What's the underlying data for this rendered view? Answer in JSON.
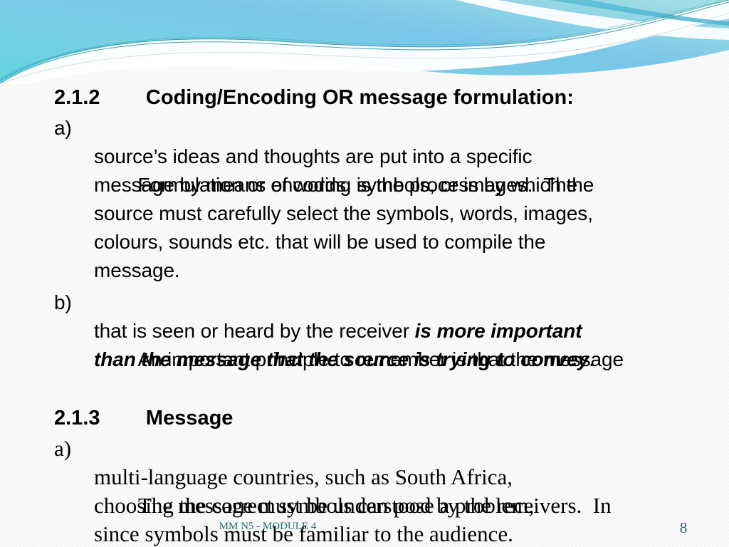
{
  "slide": {
    "background_color": "#fbfbfb",
    "accent_color": "#5ec8dd",
    "footer_color": "#1f6b73"
  },
  "sections": [
    {
      "heading": "2.1.2\tCoding/Encoding OR message formulation:",
      "font": "sans",
      "items": [
        {
          "marker": "a)",
          "lines": [
            "Formulation or encoding is the process by which the",
            "source’s ideas and thoughts are put into a specific",
            "message by means of words, symbols, or images.  The",
            "source must carefully select the symbols, words, images,",
            "colours, sounds etc. that will be used to compile the",
            "message."
          ]
        },
        {
          "marker": "b)",
          "lines": [
            "An important principle to remember is that the message",
            "that is seen or heard by the receiver ",
            "is more important",
            "than the message that the source is trying to convey",
            "."
          ],
          "emphasis_note": "is more important than the message that the source is trying to convey"
        }
      ]
    },
    {
      "heading": "2.1.3\tMessage",
      "font": "serif",
      "items": [
        {
          "marker": "a)",
          "lines": [
            "The message must be understood by the receivers.  In",
            "multi-language countries, such as South Africa,",
            "choosing the correct symbols can pose a problem,",
            "since symbols must be familiar to the audience."
          ]
        }
      ]
    }
  ],
  "footer": {
    "text": "MM N5 - MODULE 4",
    "page_number": "8"
  }
}
